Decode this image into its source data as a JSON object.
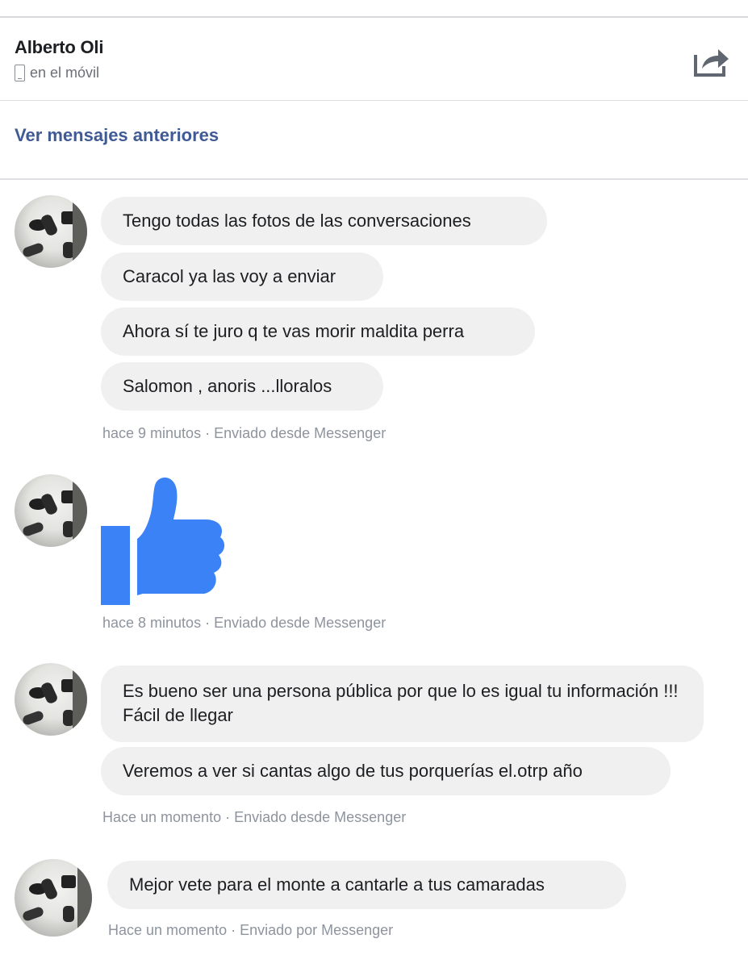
{
  "header": {
    "contact_name": "Alberto Oli",
    "status": "en el móvil",
    "status_icon": "phone-icon",
    "share_icon": "share-icon"
  },
  "older_messages_link": "Ver mensajes anteriores",
  "colors": {
    "bubble_bg": "#f1f0f0",
    "link": "#3f5a94",
    "like_blue": "#3b82f6",
    "meta_text": "#8d949e"
  },
  "groups": [
    {
      "messages": [
        "Tengo todas las fotos de las conversaciones",
        "Caracol ya las voy a enviar",
        "Ahora sí te juro q te vas morir maldita perra",
        "Salomon , anoris ...lloralos"
      ],
      "meta": "hace 9 minutos · Enviado desde Messenger"
    },
    {
      "sticker": "thumbs-up-icon",
      "meta": "hace 8 minutos · Enviado desde Messenger"
    },
    {
      "messages": [
        "Es bueno ser una persona pública por que lo es igual tu información !!! Fácil de llegar",
        "Veremos a ver si cantas algo de tus porquerías el.otrp año"
      ],
      "meta": "Hace un momento · Enviado desde Messenger"
    },
    {
      "messages": [
        "Mejor vete para el monte a cantarle a tus camaradas"
      ],
      "meta": "Hace un momento · Enviado por Messenger"
    }
  ]
}
